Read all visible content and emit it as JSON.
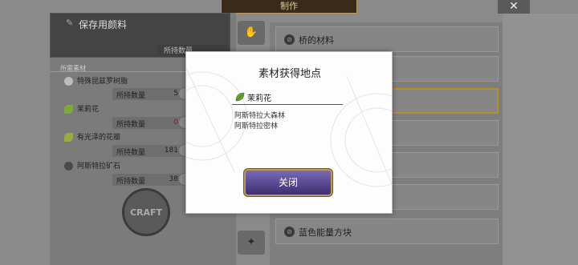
{
  "header": {
    "title": "制作"
  },
  "left": {
    "title": "保存用颜料",
    "owned_strip": "所持数量",
    "section_label": "所需素材",
    "materials": [
      {
        "name": "特殊昆兹罗树脂",
        "qty_label": "所持数量",
        "qty": "5",
        "icon_color": "#bdbdbd",
        "qty_color": "#222222"
      },
      {
        "name": "茉莉花",
        "qty_label": "所持数量",
        "qty": "0",
        "icon_color": "#7dab3a",
        "qty_color": "#8b1a1a"
      },
      {
        "name": "有光泽的花瓣",
        "qty_label": "所持数量",
        "qty": "181",
        "icon_color": "#9aa845",
        "qty_color": "#222222"
      },
      {
        "name": "阿斯特拉矿石",
        "qty_label": "所持数量",
        "qty": "38",
        "icon_color": "#4a4a4a",
        "qty_color": "#222222"
      }
    ],
    "craft_label": "CRAFT"
  },
  "recipes": [
    {
      "name": "桥的材料"
    },
    {
      "name": "蓝色能量方块"
    }
  ],
  "dialog": {
    "title": "素材获得地点",
    "item_name": "茉莉花",
    "locations": [
      "阿斯特拉大森林",
      "阿斯特拉密林"
    ],
    "close_label": "关闭"
  },
  "colors": {
    "accent_gold": "#b2912d",
    "button_purple": "#5a4a8a",
    "zero_qty": "#8b1a1a"
  }
}
